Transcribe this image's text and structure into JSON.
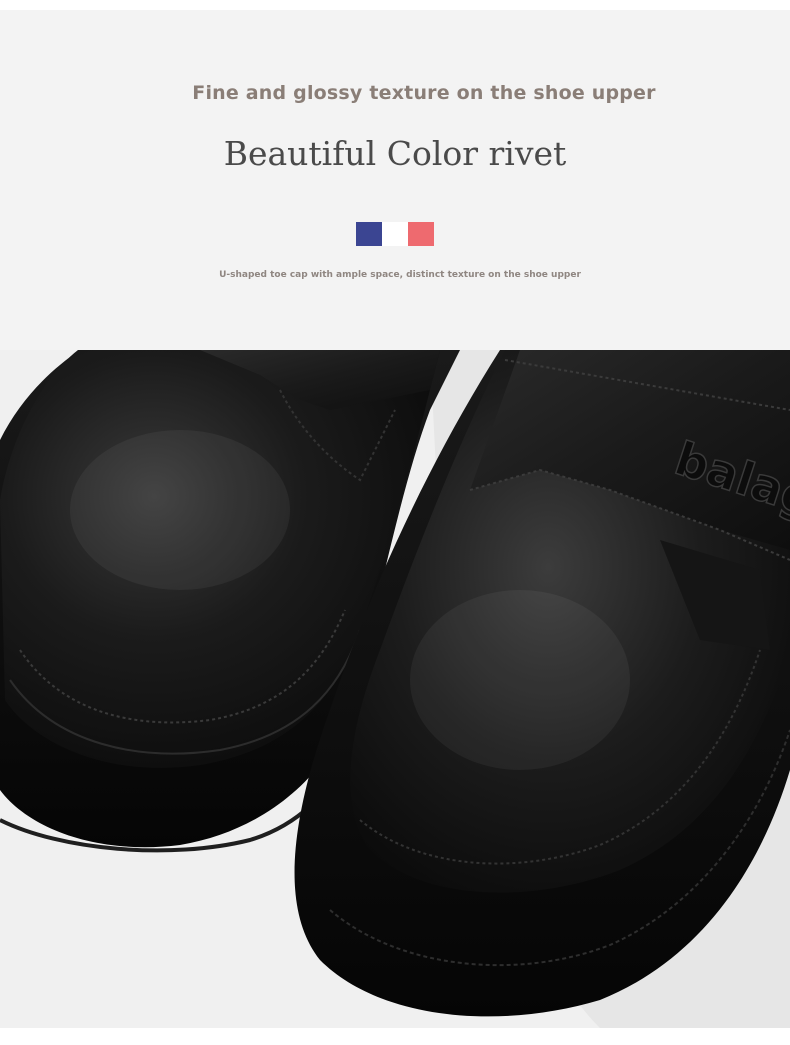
{
  "tagline": "Fine and glossy texture on the shoe upper",
  "title": "Beautiful Color rivet",
  "subtitle": "U-shaped toe cap with ample space, distinct texture on the shoe upper",
  "swatches": [
    "#3b4592",
    "#ffffff",
    "#ee6a6f"
  ],
  "brand_emboss": "balag",
  "colors": {
    "background": "#f3f3f3",
    "leather": "#141414"
  }
}
